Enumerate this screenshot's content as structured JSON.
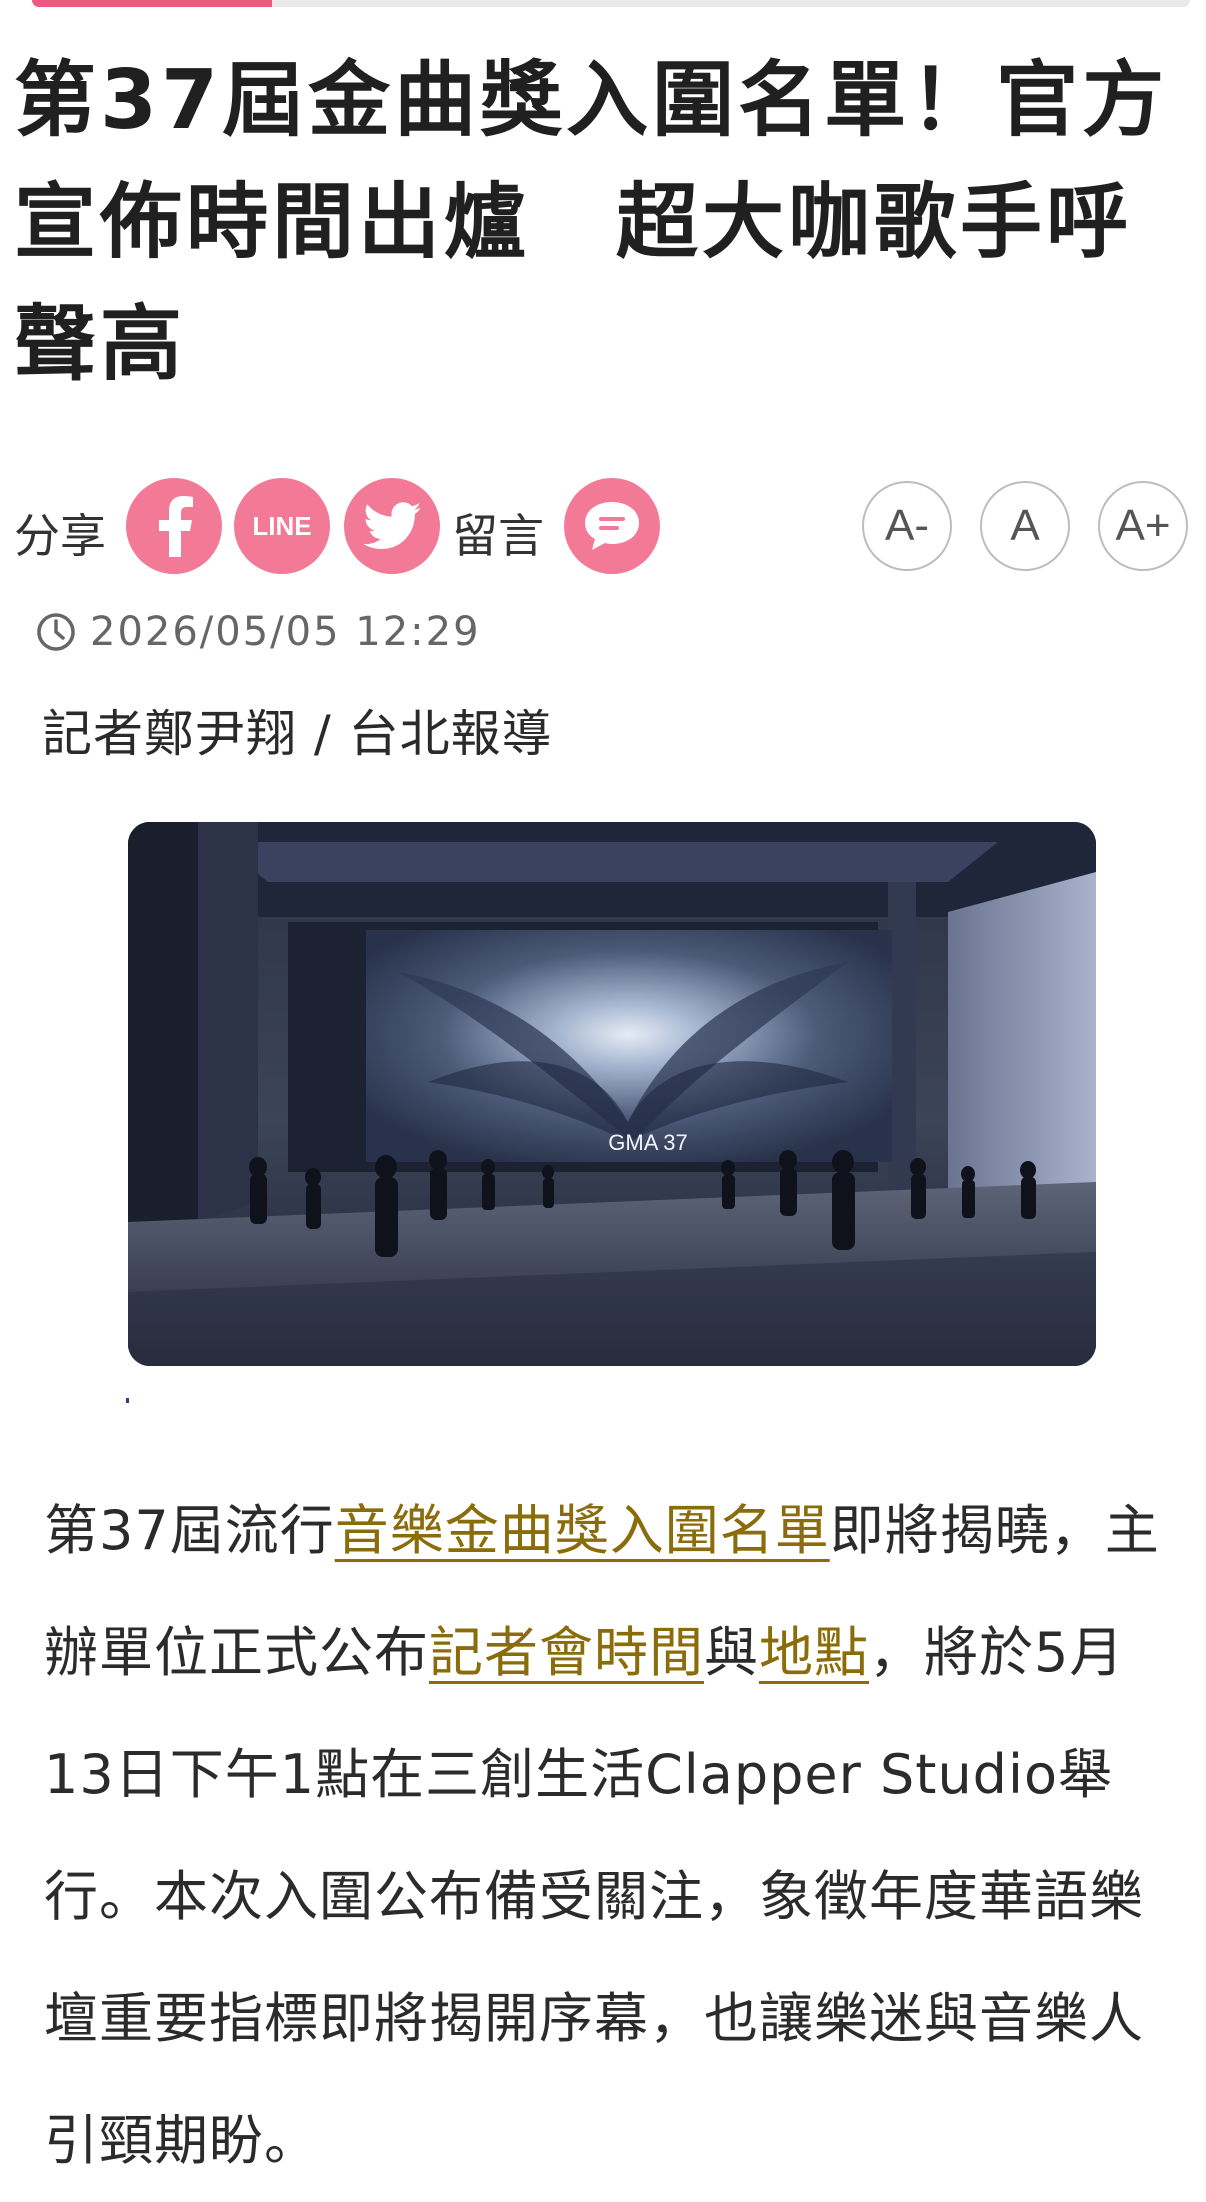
{
  "colors": {
    "accent": "#f27a96",
    "link": "#8a6d0a",
    "text": "#202020",
    "muted": "#666666"
  },
  "article": {
    "title": "第37屆金曲獎入圍名單！官方宣佈時間出爐　超大咖歌手呼聲高",
    "datetime": "2026/05/05 12:29",
    "byline": "記者鄭尹翔 / 台北報導",
    "hero_image": {
      "screen_text": "GMA 37",
      "icon": "concert-hall-photo"
    },
    "body": {
      "p1_a": "第37屆流行",
      "p1_link1": "音樂金曲獎入圍名單",
      "p1_b": "即將揭曉，主辦單位正式公布",
      "p1_link2": "記者會時間",
      "p1_c": "與",
      "p1_link3": "地點",
      "p1_d": "，將於5月13日下午1點在三創生活Clapper Studio舉行。本次入圍公布備受關注，象徵年度華語樂壇重要指標即將揭開序幕，也讓樂迷與音樂人引頸期盼。"
    }
  },
  "share": {
    "label": "分享",
    "comment_label": "留言",
    "facebook_icon": "facebook-icon",
    "line_label": "LINE",
    "twitter_icon": "twitter-icon",
    "comment_icon": "comment-bubble-icon"
  },
  "font_size": {
    "smaller": "A-",
    "normal": "A",
    "larger": "A+"
  }
}
